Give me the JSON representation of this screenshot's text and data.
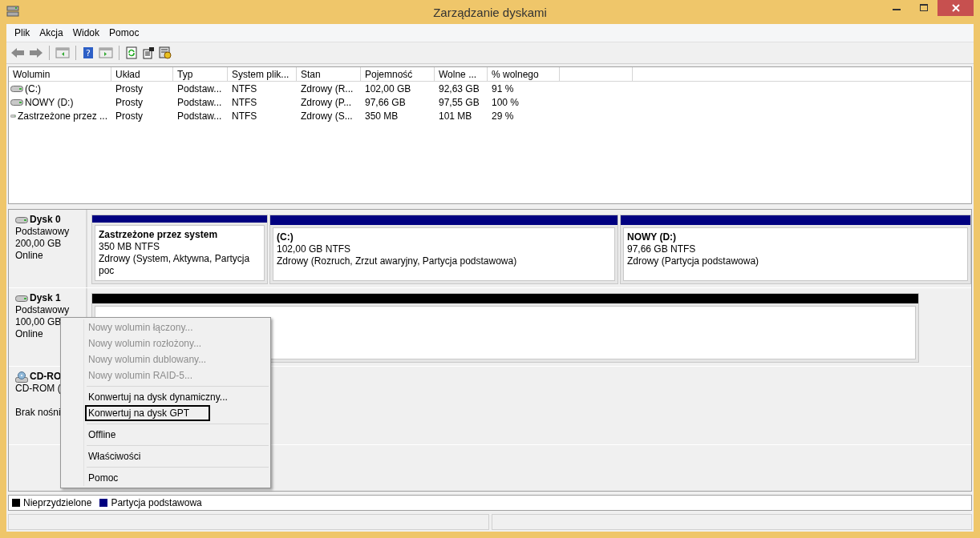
{
  "window": {
    "title": "Zarządzanie dyskami"
  },
  "menu_bar": [
    "Plik",
    "Akcja",
    "Widok",
    "Pomoc"
  ],
  "toolbar": {
    "help_glyph": "?"
  },
  "volume_table": {
    "columns": [
      "Wolumin",
      "Układ",
      "Typ",
      "System plik...",
      "Stan",
      "Pojemność",
      "Wolne ...",
      "% wolnego"
    ],
    "rows": [
      [
        "(C:)",
        "Prosty",
        "Podstaw...",
        "NTFS",
        "Zdrowy (R...",
        "102,00 GB",
        "92,63 GB",
        "91 %"
      ],
      [
        "NOWY (D:)",
        "Prosty",
        "Podstaw...",
        "NTFS",
        "Zdrowy (P...",
        "97,66 GB",
        "97,55 GB",
        "100 %"
      ],
      [
        "Zastrzeżone przez ...",
        "Prosty",
        "Podstaw...",
        "NTFS",
        "Zdrowy (S...",
        "350 MB",
        "101 MB",
        "29 %"
      ]
    ]
  },
  "disks": [
    {
      "kind": "disk",
      "name": "Dysk 0",
      "lines": [
        "Podstawowy",
        "200,00 GB",
        "Online"
      ],
      "partitions": [
        {
          "kind": "primary",
          "name": "Zastrzeżone przez system",
          "size": "350 MB NTFS",
          "status": "Zdrowy (System, Aktywna, Partycja poc"
        },
        {
          "kind": "primary",
          "name": "(C:)",
          "size": "102,00 GB NTFS",
          "status": "Zdrowy (Rozruch, Zrzut awaryjny, Partycja podstawowa)"
        },
        {
          "kind": "primary",
          "name": "NOWY  (D:)",
          "size": "97,66 GB NTFS",
          "status": "Zdrowy (Partycja podstawowa)"
        }
      ]
    },
    {
      "kind": "disk",
      "name": "Dysk 1",
      "lines": [
        "Podstawowy",
        "100,00 GB",
        "Online"
      ],
      "partitions": [
        {
          "kind": "unallocated"
        }
      ]
    },
    {
      "kind": "cdrom",
      "name": "CD-RO",
      "lines": [
        "CD-ROM (",
        "Brak nośni"
      ]
    }
  ],
  "legend": [
    {
      "label": "Nieprzydzielone",
      "color": "#000000"
    },
    {
      "label": "Partycja podstawowa",
      "color": "#000080"
    }
  ],
  "context_menu": [
    {
      "label": "Nowy wolumin łączony...",
      "disabled": true,
      "selected": false
    },
    {
      "label": "Nowy wolumin rozłożony...",
      "disabled": true,
      "selected": false
    },
    {
      "label": "Nowy wolumin dublowany...",
      "disabled": true,
      "selected": false
    },
    {
      "label": "Nowy wolumin RAID-5...",
      "disabled": true,
      "selected": false,
      "separator_after": true
    },
    {
      "label": "Konwertuj na dysk dynamiczny...",
      "disabled": false,
      "selected": false
    },
    {
      "label": "Konwertuj na dysk GPT",
      "disabled": false,
      "selected": true,
      "separator_after": true
    },
    {
      "label": "Offline",
      "disabled": false,
      "selected": false,
      "separator_after": true
    },
    {
      "label": "Właściwości",
      "disabled": false,
      "selected": false,
      "separator_after": true
    },
    {
      "label": "Pomoc",
      "disabled": false,
      "selected": false
    }
  ]
}
